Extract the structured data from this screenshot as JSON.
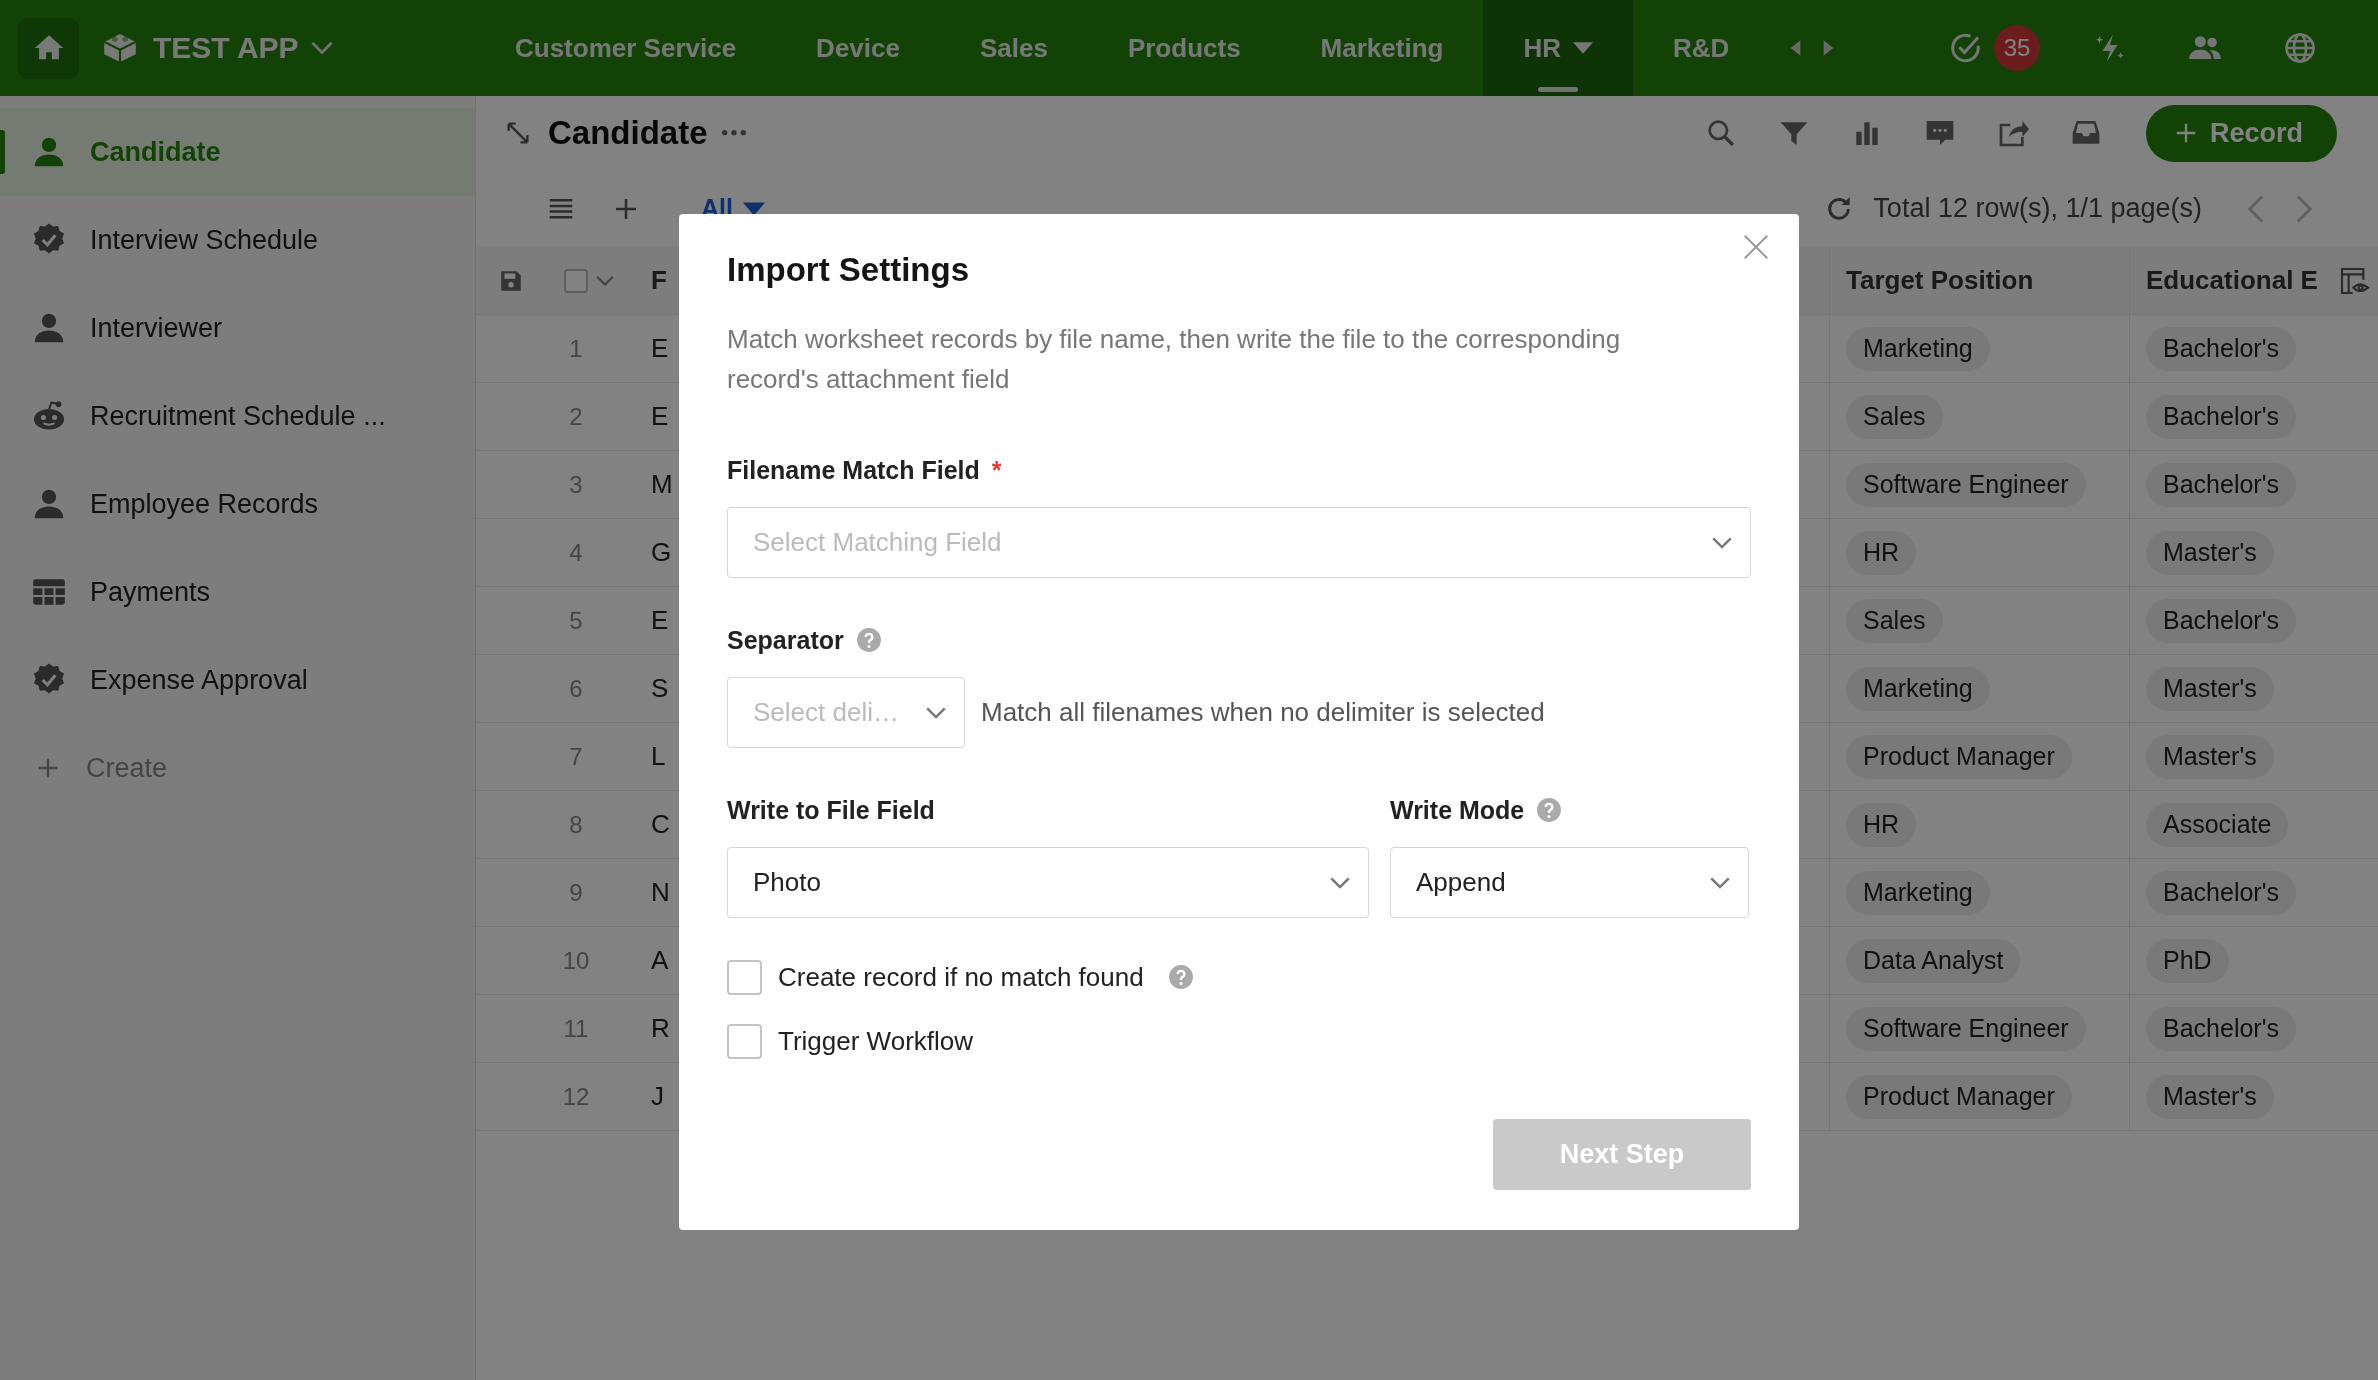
{
  "top_bar": {
    "app_name": "TEST APP",
    "nav": [
      {
        "label": "Customer Service",
        "selected": false,
        "dropdown": false
      },
      {
        "label": "Device",
        "selected": false,
        "dropdown": false
      },
      {
        "label": "Sales",
        "selected": false,
        "dropdown": false
      },
      {
        "label": "Products",
        "selected": false,
        "dropdown": false
      },
      {
        "label": "Marketing",
        "selected": false,
        "dropdown": false
      },
      {
        "label": "HR",
        "selected": true,
        "dropdown": true
      },
      {
        "label": "R&D",
        "selected": false,
        "dropdown": false
      }
    ],
    "notification_count": "35"
  },
  "sidebar": {
    "items": [
      {
        "label": "Candidate",
        "selected": true
      },
      {
        "label": "Interview Schedule",
        "selected": false
      },
      {
        "label": "Interviewer",
        "selected": false
      },
      {
        "label": "Recruitment Schedule ...",
        "selected": false
      },
      {
        "label": "Employee Records",
        "selected": false
      },
      {
        "label": "Payments",
        "selected": false
      },
      {
        "label": "Expense Approval",
        "selected": false
      }
    ],
    "create_label": "Create"
  },
  "view": {
    "title": "Candidate",
    "record_button": "Record",
    "view_tab": "All",
    "total": "Total 12 row(s), 1/1 page(s)"
  },
  "table": {
    "select_all": {
      "checked": false
    },
    "columns": [
      "F",
      "Target Position",
      "Educational E"
    ],
    "rows": [
      {
        "number": "1",
        "column_1": "E",
        "target_position": "Marketing",
        "education": "Bachelor's"
      },
      {
        "number": "2",
        "column_1": "E",
        "target_position": "Sales",
        "education": "Bachelor's"
      },
      {
        "number": "3",
        "column_1": "M",
        "target_position": "Software Engineer",
        "education": "Bachelor's"
      },
      {
        "number": "4",
        "column_1": "G",
        "target_position": "HR",
        "education": "Master's"
      },
      {
        "number": "5",
        "column_1": "E",
        "target_position": "Sales",
        "education": "Bachelor's"
      },
      {
        "number": "6",
        "column_1": "S",
        "target_position": "Marketing",
        "education": "Master's"
      },
      {
        "number": "7",
        "column_1": "L",
        "target_position": "Product Manager",
        "education": "Master's"
      },
      {
        "number": "8",
        "column_1": "C",
        "target_position": "HR",
        "education": "Associate"
      },
      {
        "number": "9",
        "column_1": "N",
        "target_position": "Marketing",
        "education": "Bachelor's"
      },
      {
        "number": "10",
        "column_1": "A",
        "target_position": "Data Analyst",
        "education": "PhD"
      },
      {
        "number": "11",
        "column_1": "R",
        "target_position": "Software Engineer",
        "education": "Bachelor's"
      },
      {
        "number": "12",
        "column_1": "J",
        "target_position": "Product Manager",
        "education": "Master's"
      }
    ]
  },
  "dialog": {
    "title": "Import Settings",
    "description": "Match worksheet records by file name, then write the file to the corresponding record's attachment field",
    "filename_field": {
      "label": "Filename Match Field",
      "required_mark": "*",
      "placeholder": "Select Matching Field"
    },
    "separator": {
      "label": "Separator",
      "placeholder": "Select deli…",
      "hint": "Match all filenames when no delimiter is selected"
    },
    "write_field": {
      "label": "Write to File Field",
      "value": "Photo"
    },
    "write_mode": {
      "label": "Write Mode",
      "value": "Append"
    },
    "options": [
      {
        "label": "Create record if no match found",
        "checked": false,
        "help": true
      },
      {
        "label": "Trigger Workflow",
        "checked": false,
        "help": false
      }
    ],
    "next_button": {
      "label": "Next Step",
      "disabled": true
    }
  }
}
